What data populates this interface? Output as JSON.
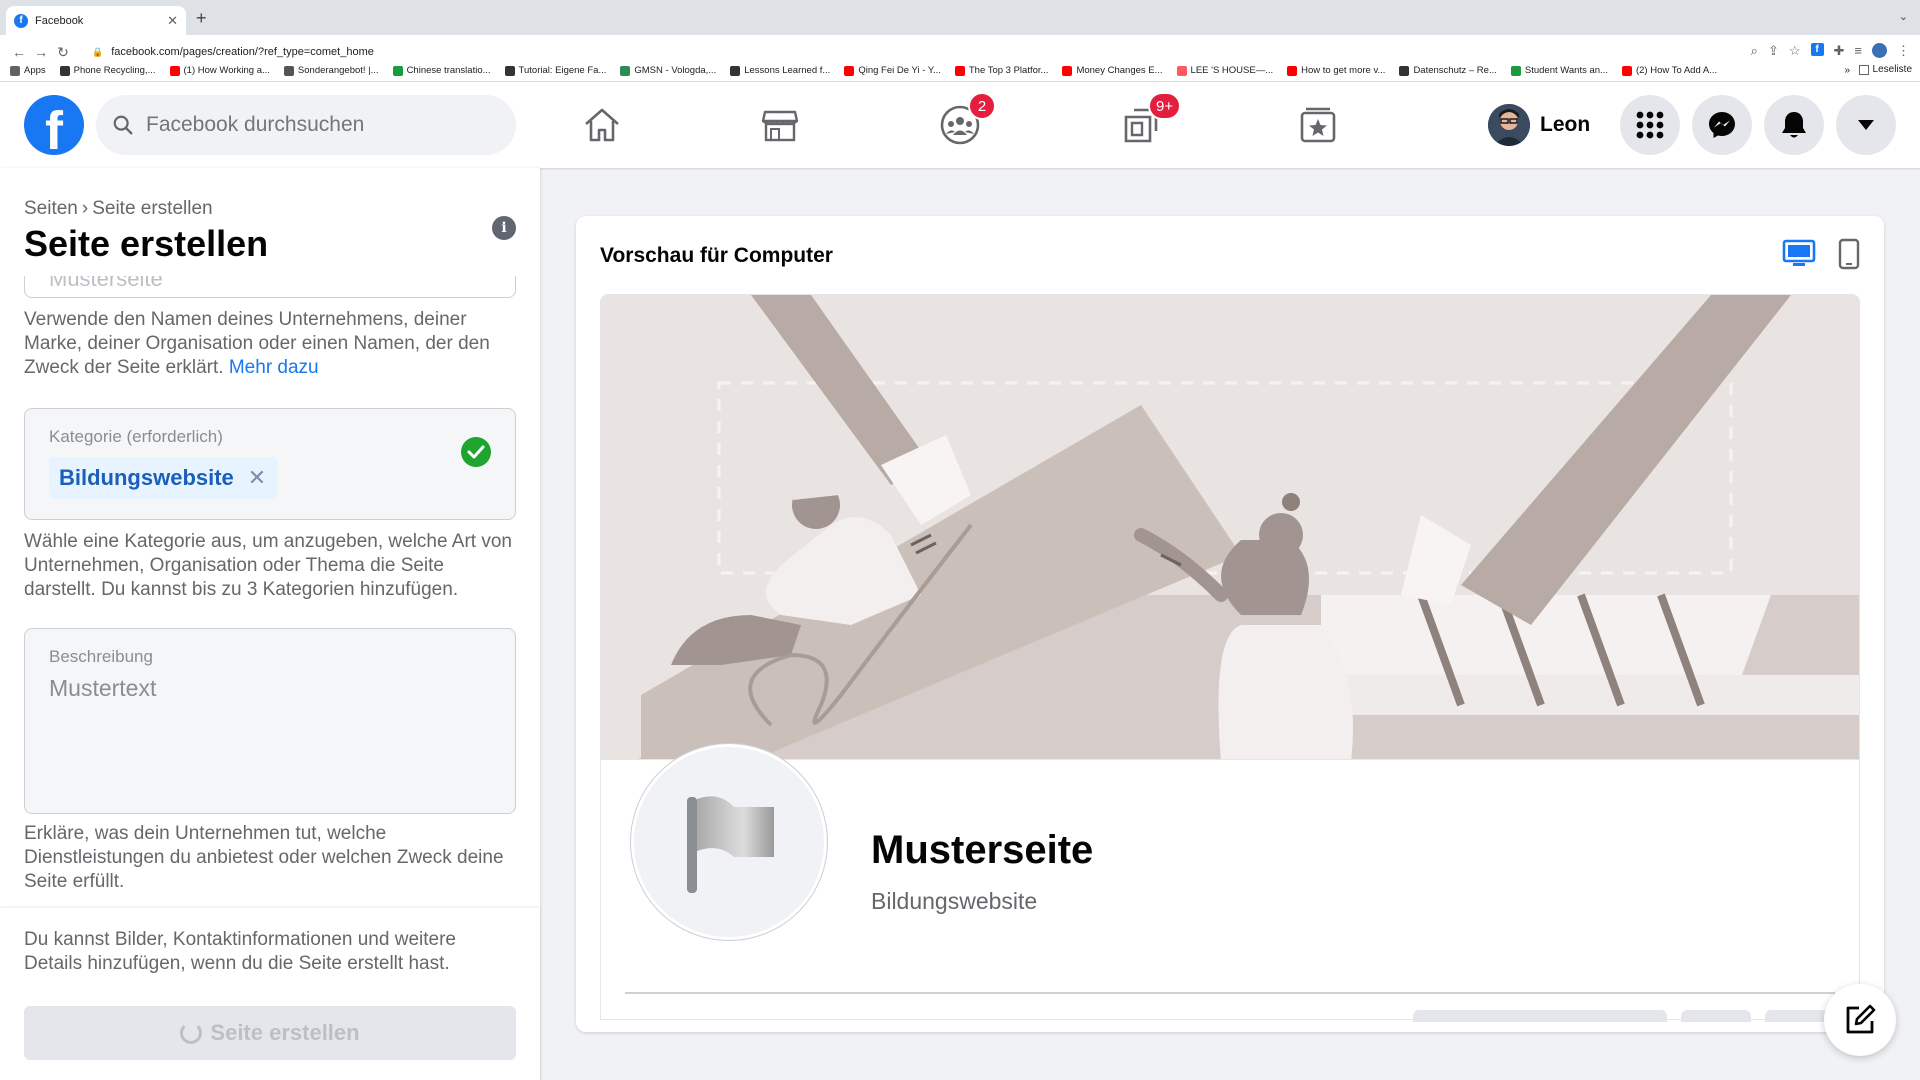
{
  "browser": {
    "tab_title": "Facebook",
    "tab_favicon": "f",
    "url": "facebook.com/pages/creation/?ref_type=comet_home",
    "bookmarks": [
      {
        "label": "Apps",
        "color": "#5f6368"
      },
      {
        "label": "Phone Recycling,...",
        "color": "#333"
      },
      {
        "label": "(1) How Working a...",
        "color": "#ff0000"
      },
      {
        "label": "Sonderangebot! |...",
        "color": "#555"
      },
      {
        "label": "Chinese translatio...",
        "color": "#1a9c3e"
      },
      {
        "label": "Tutorial: Eigene Fa...",
        "color": "#333"
      },
      {
        "label": "GMSN - Vologda,...",
        "color": "#2e8b57"
      },
      {
        "label": "Lessons Learned f...",
        "color": "#333"
      },
      {
        "label": "Qing Fei De Yi - Y...",
        "color": "#ff0000"
      },
      {
        "label": "The Top 3 Platfor...",
        "color": "#ff0000"
      },
      {
        "label": "Money Changes E...",
        "color": "#ff0000"
      },
      {
        "label": "LEE 'S HOUSE—...",
        "color": "#ff5a5f"
      },
      {
        "label": "How to get more v...",
        "color": "#ff0000"
      },
      {
        "label": "Datenschutz – Re...",
        "color": "#333"
      },
      {
        "label": "Student Wants an...",
        "color": "#1a9c3e"
      },
      {
        "label": "(2) How To Add A...",
        "color": "#ff0000"
      }
    ],
    "bookmarks_more": "»",
    "reading_list": "Leseliste"
  },
  "header": {
    "logo": "f",
    "search_placeholder": "Facebook durchsuchen",
    "groups_badge": "2",
    "gaming_badge": "9+",
    "profile_name": "Leon"
  },
  "left": {
    "breadcrumb_parent": "Seiten",
    "breadcrumb_sep": "›",
    "breadcrumb_current": "Seite erstellen",
    "title": "Seite erstellen",
    "name_value_cut": "Musterseite",
    "name_help": "Verwende den Namen deines Unternehmens, deiner Marke, deiner Organisation oder einen Namen, der den Zweck der Seite erklärt.",
    "name_help_link": "Mehr dazu",
    "category_label": "Kategorie (erforderlich)",
    "category_chip": "Bildungswebsite",
    "category_help": "Wähle eine Kategorie aus, um anzugeben, welche Art von Unternehmen, Organisation oder Thema die Seite darstellt. Du kannst bis zu 3 Kategorien hinzufügen.",
    "description_label": "Beschreibung",
    "description_value": "Mustertext",
    "description_help": "Erkläre, was dein Unternehmen tut, welche Dienstleistungen du anbietest oder welchen Zweck deine Seite erfüllt.",
    "footer_note": "Du kannst Bilder, Kontaktinformationen und weitere Details hinzufügen, wenn du die Seite erstellt hast.",
    "create_button": "Seite erstellen"
  },
  "preview": {
    "title": "Vorschau für Computer",
    "page_name": "Musterseite",
    "page_category": "Bildungswebsite"
  },
  "colors": {
    "brand": "#1877f2",
    "badge": "#e41e3f",
    "success": "#1fa42f"
  }
}
